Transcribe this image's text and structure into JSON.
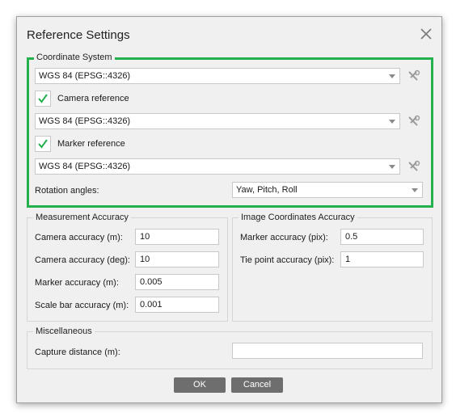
{
  "dialog": {
    "title": "Reference Settings",
    "close_icon": "close-icon"
  },
  "coordinate_system": {
    "legend": "Coordinate System",
    "project_crs": "WGS 84 (EPSG::4326)",
    "camera_reference_label": "Camera reference",
    "camera_reference_checked": true,
    "camera_crs": "WGS 84 (EPSG::4326)",
    "marker_reference_label": "Marker reference",
    "marker_reference_checked": true,
    "marker_crs": "WGS 84 (EPSG::4326)",
    "rotation_angles_label": "Rotation angles:",
    "rotation_angles_value": "Yaw, Pitch, Roll",
    "highlight_color": "#22b14c"
  },
  "measurement_accuracy": {
    "legend": "Measurement Accuracy",
    "camera_accuracy_m_label": "Camera accuracy (m):",
    "camera_accuracy_m_value": "10",
    "camera_accuracy_deg_label": "Camera accuracy (deg):",
    "camera_accuracy_deg_value": "10",
    "marker_accuracy_m_label": "Marker accuracy (m):",
    "marker_accuracy_m_value": "0.005",
    "scale_bar_accuracy_label": "Scale bar accuracy (m):",
    "scale_bar_accuracy_value": "0.001"
  },
  "image_coordinates_accuracy": {
    "legend": "Image Coordinates Accuracy",
    "marker_accuracy_pix_label": "Marker accuracy (pix):",
    "marker_accuracy_pix_value": "0.5",
    "tie_point_accuracy_label": "Tie point accuracy (pix):",
    "tie_point_accuracy_value": "1"
  },
  "miscellaneous": {
    "legend": "Miscellaneous",
    "capture_distance_label": "Capture distance (m):",
    "capture_distance_value": ""
  },
  "buttons": {
    "ok": "OK",
    "cancel": "Cancel"
  }
}
